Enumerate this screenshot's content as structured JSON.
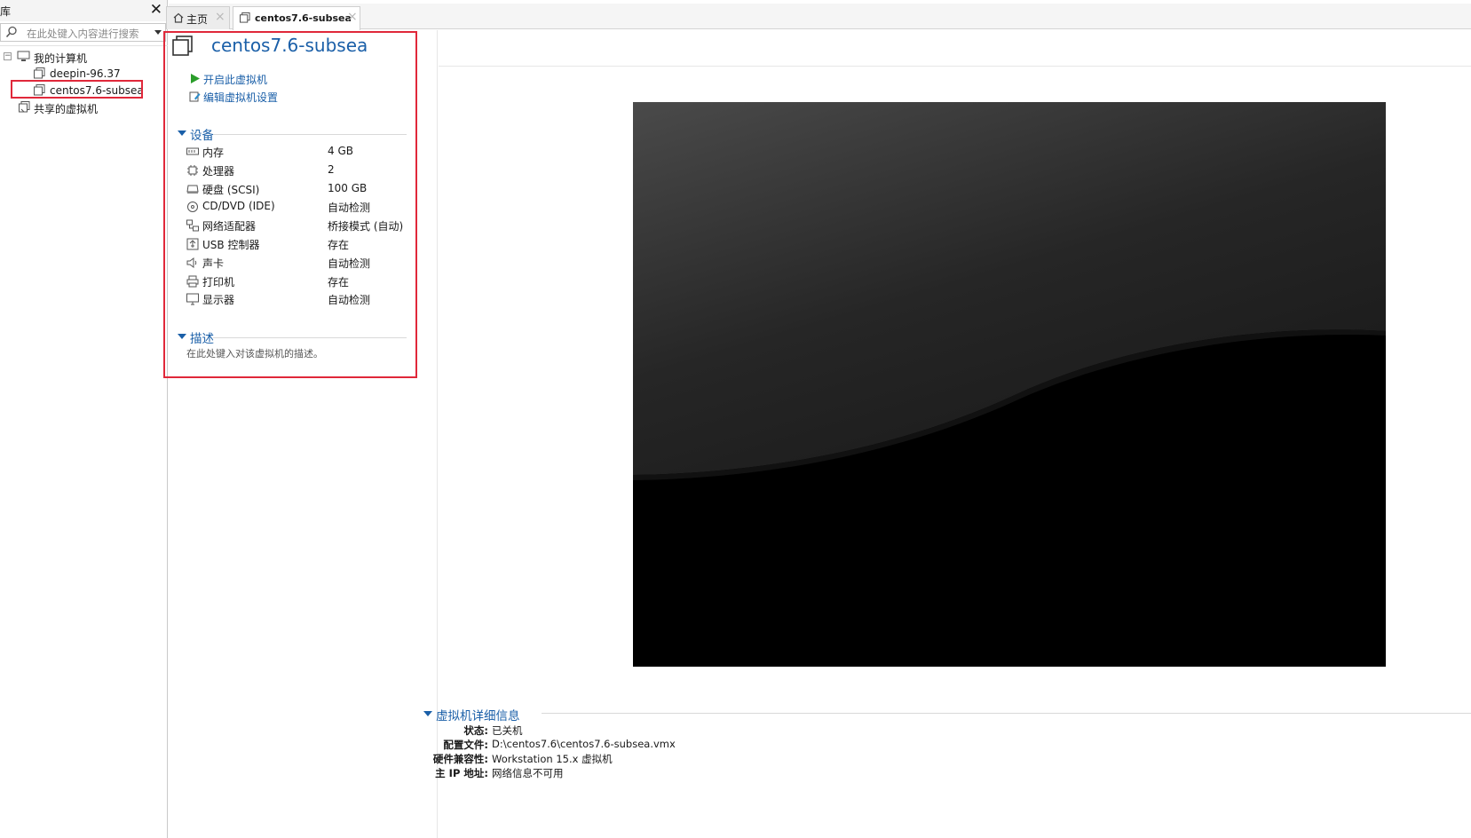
{
  "library": {
    "title": "库",
    "close_label": "✕",
    "search_placeholder": "在此处键入内容进行搜索",
    "tree": {
      "my_computer": "我的计算机",
      "vms": [
        "deepin-96.37",
        "centos7.6-subsea"
      ],
      "shared": "共享的虚拟机",
      "selected": "centos7.6-subsea"
    }
  },
  "tabs": [
    {
      "label": "主页",
      "icon": "home-icon",
      "close": "×"
    },
    {
      "label": "centos7.6-subsea",
      "icon": "vm-icon",
      "close": "×",
      "active": true
    }
  ],
  "summary": {
    "vm_name": "centos7.6-subsea",
    "actions": {
      "power_on": "开启此虚拟机",
      "edit_settings": "编辑虚拟机设置"
    },
    "devices_header": "设备",
    "devices": [
      {
        "icon": "memory-icon",
        "name": "内存",
        "value": "4 GB"
      },
      {
        "icon": "processor-icon",
        "name": "处理器",
        "value": "2"
      },
      {
        "icon": "hard-disk-icon",
        "name": "硬盘 (SCSI)",
        "value": "100 GB"
      },
      {
        "icon": "cd-dvd-icon",
        "name": "CD/DVD (IDE)",
        "value": "自动检测"
      },
      {
        "icon": "network-adapter-icon",
        "name": "网络适配器",
        "value": "桥接模式 (自动)"
      },
      {
        "icon": "usb-icon",
        "name": "USB 控制器",
        "value": "存在"
      },
      {
        "icon": "sound-card-icon",
        "name": "声卡",
        "value": "自动检测"
      },
      {
        "icon": "printer-icon",
        "name": "打印机",
        "value": "存在"
      },
      {
        "icon": "display-icon",
        "name": "显示器",
        "value": "自动检测"
      }
    ],
    "description_header": "描述",
    "description_placeholder": "在此处键入对该虚拟机的描述。"
  },
  "details": {
    "header": "虚拟机详细信息",
    "rows": [
      {
        "key": "状态:",
        "value": "已关机"
      },
      {
        "key": "配置文件:",
        "value": "D:\\centos7.6\\centos7.6-subsea.vmx"
      },
      {
        "key": "硬件兼容性:",
        "value": "Workstation 15.x 虚拟机"
      },
      {
        "key": "主 IP 地址:",
        "value": "网络信息不可用"
      }
    ]
  },
  "colors": {
    "accent": "#1a5fa8",
    "highlight_box": "#e0283a",
    "play_green": "#2a9d2a"
  }
}
